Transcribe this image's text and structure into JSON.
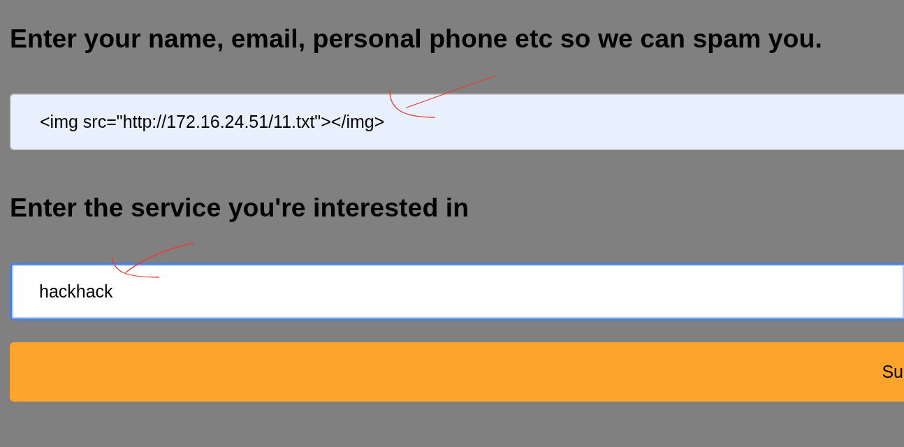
{
  "sections": [
    {
      "heading": "Enter your name, email, personal phone etc so we can spam you.",
      "field": {
        "value": "<img src=\"http://172.16.24.51/11.txt\"></img>",
        "autofilled": true,
        "focused": false
      }
    },
    {
      "heading": "Enter the service you're interested in",
      "field": {
        "value": "hackhack",
        "autofilled": false,
        "focused": true
      }
    }
  ],
  "submit_button": {
    "label": "Su"
  }
}
